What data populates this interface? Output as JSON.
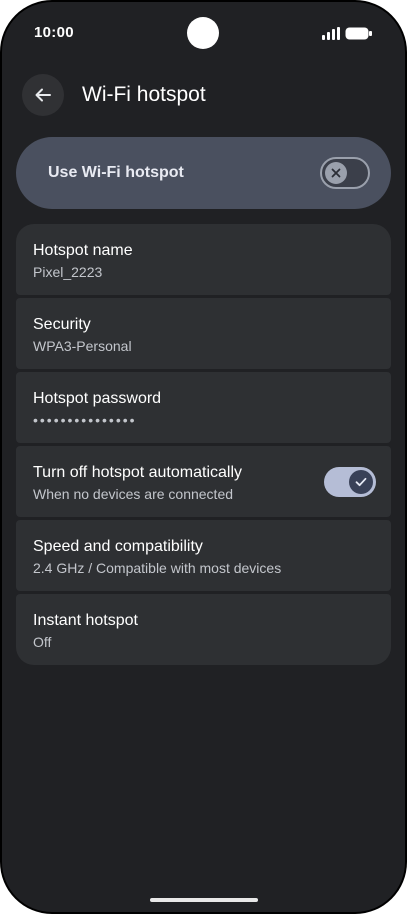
{
  "status_bar": {
    "time": "10:00"
  },
  "header": {
    "title": "Wi-Fi hotspot",
    "back_icon": "arrow-back-icon"
  },
  "master_toggle": {
    "label": "Use Wi-Fi hotspot",
    "state": "off",
    "icon": "close-icon"
  },
  "settings": [
    {
      "title": "Hotspot name",
      "subtitle": "Pixel_2223"
    },
    {
      "title": "Security",
      "subtitle": "WPA3-Personal"
    },
    {
      "title": "Hotspot password",
      "subtitle": "•••••••••••••••"
    },
    {
      "title": "Turn off hotspot automatically",
      "subtitle": "When no devices are connected",
      "toggle": "on",
      "icon": "check-icon"
    },
    {
      "title": "Speed and compatibility",
      "subtitle": "2.4 GHz / Compatible with most devices"
    },
    {
      "title": "Instant hotspot",
      "subtitle": "Off"
    }
  ],
  "colors": {
    "background": "#202124",
    "card": "#2e3033",
    "master_toggle_bg": "#4a505f",
    "switch_on_track": "#b5bdd6",
    "switch_on_thumb": "#394158"
  }
}
